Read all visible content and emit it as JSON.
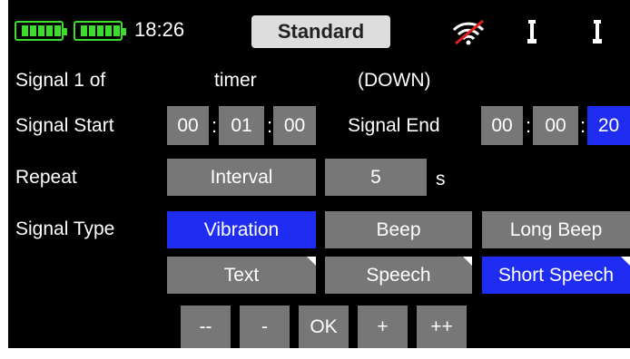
{
  "status": {
    "time": "18:26",
    "mode": "Standard",
    "colors": {
      "battery": "#3ddc2f",
      "selected": "#1f2df2",
      "button": "#777777",
      "signal_off": "#e02020"
    }
  },
  "row1": {
    "label": "Signal 1 of",
    "source": "timer",
    "direction": "(DOWN)"
  },
  "row2": {
    "start_label": "Signal Start",
    "start": [
      "00",
      "01",
      "00"
    ],
    "end_label": "Signal End",
    "end": [
      "00",
      "00",
      "20"
    ],
    "separator": ":"
  },
  "row3": {
    "label": "Repeat",
    "mode": "Interval",
    "count": "5",
    "unit": "s"
  },
  "row4": {
    "label": "Signal Type",
    "vibration": "Vibration",
    "beep": "Beep",
    "long_beep": "Long Beep",
    "text": "Text",
    "speech": "Speech",
    "short_speech": "Short Speech"
  },
  "keypad": {
    "minus_minus": "--",
    "minus": "-",
    "ok": "OK",
    "plus": "+",
    "plus_plus": "++"
  }
}
